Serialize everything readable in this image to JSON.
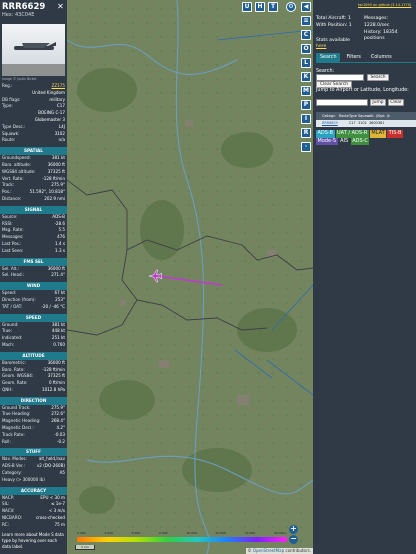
{
  "aircraft": {
    "callsign": "RRR6629",
    "hex_label": "Hex:",
    "hex": "43C04E",
    "close_glyph": "✕",
    "photo_caption": "Image © Justin Bickel"
  },
  "info_top": [
    {
      "k": "Reg.:",
      "v": "ZZ175",
      "link": true
    },
    {
      "k": "",
      "v": "United Kingdom"
    },
    {
      "k": "DB flags:",
      "v": "military"
    },
    {
      "k": "Type:",
      "v": "C17"
    },
    {
      "k": "",
      "v": "BOEING C-17"
    },
    {
      "k": "",
      "v": "Globemaster 3"
    },
    {
      "k": "Type Desc.:",
      "v": "L4J"
    },
    {
      "k": "Squawk:",
      "v": "3102"
    },
    {
      "k": "Route:",
      "v": "n/a"
    }
  ],
  "sections": [
    {
      "title": "SPATIAL",
      "rows": [
        {
          "k": "Groundspeed:",
          "v": "381 kt"
        },
        {
          "k": "Baro. altitude:",
          "v": "36000 ft"
        },
        {
          "k": "WGS84 altitude:",
          "v": "37325 ft"
        },
        {
          "k": "Vert. Rate:",
          "v": "-128 ft/min"
        },
        {
          "k": "Track:",
          "v": "275.9°"
        },
        {
          "k": "Pos.:",
          "v": "51.592°, 10.818°"
        },
        {
          "k": "Distance:",
          "v": "202.9 nmi"
        }
      ]
    },
    {
      "title": "SIGNAL",
      "rows": [
        {
          "k": "Source:",
          "v": "ADS-B"
        },
        {
          "k": "RSSI:",
          "v": "-28.6"
        },
        {
          "k": "Msg. Rate:",
          "v": "5.5"
        },
        {
          "k": "Messages:",
          "v": "476"
        },
        {
          "k": "Last Pos.:",
          "v": "1.4 s"
        },
        {
          "k": "Last Seen:",
          "v": "1.3 s"
        }
      ]
    },
    {
      "title": "FMS SEL",
      "rows": [
        {
          "k": "Sel. Alt.:",
          "v": "36000 ft"
        },
        {
          "k": "Sel. Head.:",
          "v": "271.4°"
        }
      ]
    },
    {
      "title": "WIND",
      "rows": [
        {
          "k": "Speed:",
          "v": "67 kt"
        },
        {
          "k": "Direction (from):",
          "v": "253°"
        },
        {
          "k": "TAT / OAT:",
          "v": "-20 / -46 °C"
        }
      ]
    },
    {
      "title": "SPEED",
      "rows": [
        {
          "k": "Ground:",
          "v": "381 kt"
        },
        {
          "k": "True:",
          "v": "448 kt"
        },
        {
          "k": "Indicated:",
          "v": "251 kt"
        },
        {
          "k": "Mach:",
          "v": "0.760"
        }
      ]
    },
    {
      "title": "ALTITUDE",
      "rows": [
        {
          "k": "Barometric:",
          "v": "36000 ft"
        },
        {
          "k": "Baro. Rate:",
          "v": "-128 ft/min"
        },
        {
          "k": "Geom. WGS84:",
          "v": "37325 ft"
        },
        {
          "k": "Geom. Rate:",
          "v": "0 ft/min"
        },
        {
          "k": "QNH:",
          "v": "1012.8 hPa"
        }
      ]
    },
    {
      "title": "DIRECTION",
      "rows": [
        {
          "k": "Ground Track:",
          "v": "275.9°"
        },
        {
          "k": "True Heading:",
          "v": "272.6°"
        },
        {
          "k": "Magnetic Heading:",
          "v": "268.4°"
        },
        {
          "k": "Magnetic Decl.:",
          "v": "4.2°"
        },
        {
          "k": "Track Rate:",
          "v": "-0.03"
        },
        {
          "k": "Roll:",
          "v": "-0.2"
        }
      ]
    },
    {
      "title": "STUFF",
      "rows": [
        {
          "k": "Nav. Modes:",
          "v": "alt_hold,lnav"
        },
        {
          "k": "ADS-B Ver.:",
          "v": "v2 (DO-260B)"
        },
        {
          "k": "Category:",
          "v": "A5"
        },
        {
          "k": "Heavy (> 300000 lb)",
          "v": ""
        }
      ]
    },
    {
      "title": "ACCURACY",
      "rows": [
        {
          "k": "NACP:",
          "v": "EPU < 30 m"
        },
        {
          "k": "SIL:",
          "v": "≤ 1e-7"
        },
        {
          "k": "NACV:",
          "v": "< 3 m/s"
        },
        {
          "k": "NICBARO:",
          "v": "cross-checked"
        },
        {
          "k": "RC:",
          "v": "75 m"
        }
      ]
    }
  ],
  "learn_more": "Learn more about Mode S data type by hovering over each data label.",
  "map": {
    "top_buttons": [
      "U",
      "H",
      "T"
    ],
    "side_buttons": [
      "C",
      "O",
      "L",
      "K",
      "M",
      "P",
      "I",
      "R"
    ],
    "back_glyph": "◀",
    "zoom_in": "+",
    "zoom_out": "−",
    "colorbar_labels": [
      "2 000",
      "4 000",
      "6 000",
      "8 000",
      "10 000",
      "20 000",
      "30 000",
      "40 000+"
    ],
    "scale_label": "5 km",
    "attribution_prefix": "© ",
    "attribution_link": "OpenStreetMap",
    "attribution_suffix": " contributors.",
    "colors": {
      "track": "#c236d6",
      "aircraft": "#c236d6",
      "border": "#3b3f47",
      "river": "#6aa0c8"
    }
  },
  "right": {
    "link": "tar1090 on github (3.14.1770)",
    "stats": {
      "total_label": "Total Aircraft:",
      "total_value": "1",
      "withpos_label": "With Position:",
      "withpos_value": "1",
      "messages_label": "Messages:",
      "messages_value": "1228.0/sec",
      "history_label": "History:",
      "history_value": "18354 positions",
      "all_label": "Stats available",
      "all_link": "here"
    },
    "tabs": [
      "Search",
      "Filters",
      "Columns"
    ],
    "search_label": "Search:",
    "search_button": "Search",
    "clear_search": "Clear Search",
    "jump_label": "Jump to Airport or Latitude, Longitude:",
    "jump_button": "Jump",
    "clear_button": "Clear",
    "table_headers": [
      "",
      "Callsign",
      "Route",
      "Type",
      "Squawk",
      "Alt. (ft)",
      "Spd. (kt)",
      "",
      ""
    ],
    "table_row": [
      "",
      "RRR6629",
      "",
      "C17",
      "3102",
      "36000",
      "381",
      "",
      ""
    ],
    "legend": [
      "ADS-B",
      "UAT / ADS-R",
      "MLAT",
      "TIS-B",
      "Mode-S",
      "AIS",
      "ADS-C"
    ]
  }
}
